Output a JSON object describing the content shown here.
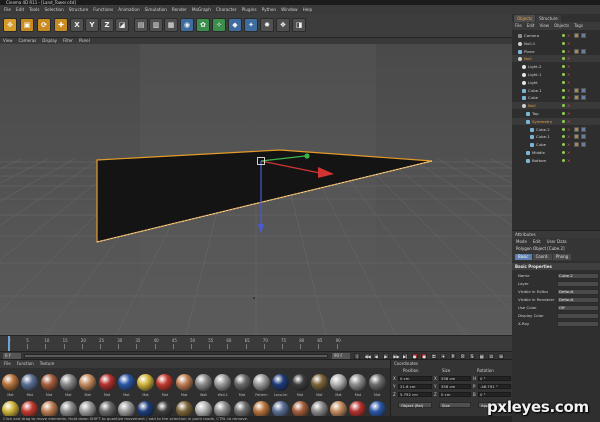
{
  "window": {
    "title": "Cinema 4D R11 - [Land_Tower.c4d]"
  },
  "menu": [
    "File",
    "Edit",
    "Tools",
    "Selection",
    "Structure",
    "Functions",
    "Animation",
    "Simulation",
    "Render",
    "MoGraph",
    "Character",
    "Plugins",
    "Python",
    "Window",
    "Help"
  ],
  "toolbar": {
    "buttons": [
      {
        "glyph": "✥",
        "style": "sel",
        "name": "move-tool-icon"
      },
      {
        "glyph": "▣",
        "style": "o",
        "name": "scale-tool-icon"
      },
      {
        "glyph": "⟳",
        "style": "o",
        "name": "rotate-tool-icon"
      },
      {
        "glyph": "✚",
        "style": "o",
        "name": "live-selection-icon"
      },
      {
        "glyph": "X",
        "style": "",
        "name": "x-axis-icon"
      },
      {
        "glyph": "Y",
        "style": "",
        "name": "y-axis-icon"
      },
      {
        "glyph": "Z",
        "style": "",
        "name": "z-axis-icon"
      },
      {
        "glyph": "◪",
        "style": "",
        "name": "coordinate-system-icon"
      },
      {
        "glyph": "▤",
        "style": "",
        "name": "render-view-icon"
      },
      {
        "glyph": "▥",
        "style": "",
        "name": "render-picture-viewer-icon"
      },
      {
        "glyph": "▦",
        "style": "",
        "name": "render-settings-icon"
      },
      {
        "glyph": "◉",
        "style": "b",
        "name": "cube-primitive-icon"
      },
      {
        "glyph": "✿",
        "style": "g",
        "name": "nurbs-icon"
      },
      {
        "glyph": "✧",
        "style": "g",
        "name": "array-icon"
      },
      {
        "glyph": "◆",
        "style": "b",
        "name": "deformer-icon"
      },
      {
        "glyph": "✦",
        "style": "b",
        "name": "scene-icon"
      },
      {
        "glyph": "✹",
        "style": "",
        "name": "light-icon"
      },
      {
        "glyph": "❖",
        "style": "",
        "name": "effector-icon"
      },
      {
        "glyph": "◨",
        "style": "",
        "name": "camera-icon"
      }
    ]
  },
  "viewport": {
    "menu": [
      "View",
      "Cameras",
      "Display",
      "Filter",
      "Panel"
    ]
  },
  "timeline": {
    "ticks": [
      "0",
      "5",
      "10",
      "15",
      "20",
      "25",
      "30",
      "35",
      "40",
      "45",
      "50",
      "55",
      "60",
      "65",
      "70",
      "75",
      "80",
      "85",
      "90"
    ],
    "start": "0 F",
    "end": "90 F",
    "frame_field": "0 F"
  },
  "materials": {
    "menu": [
      "File",
      "Function",
      "Texture"
    ],
    "items": [
      {
        "label": "Mat",
        "color": "#b8743b"
      },
      {
        "label": "Mat",
        "color": "#5a6f95"
      },
      {
        "label": "Mat",
        "color": "#a65e3b"
      },
      {
        "label": "Mat",
        "color": "#8a8a8a"
      },
      {
        "label": "Mat",
        "color": "#c38b5d"
      },
      {
        "label": "Mat",
        "color": "#b4312d"
      },
      {
        "label": "Mat",
        "color": "#2a56a8"
      },
      {
        "label": "Mat",
        "color": "#d0b33a"
      },
      {
        "label": "Mat",
        "color": "#c23a2e"
      },
      {
        "label": "Mat",
        "color": "#bf7d52"
      },
      {
        "label": "Wall",
        "color": "#8c8c8c"
      },
      {
        "label": "Wall.1",
        "color": "#9b9b9b"
      },
      {
        "label": "Mat",
        "color": "#6a6a6a"
      },
      {
        "label": "Pattern",
        "color": "#9a9a9a"
      },
      {
        "label": "Lava-Im",
        "color": "#1d3c7a"
      },
      {
        "label": "Mat",
        "color": "#3c3c3c"
      },
      {
        "label": "Mat",
        "color": "#7b6438"
      },
      {
        "label": "Mat",
        "color": "#b4b4b4"
      },
      {
        "label": "Mat",
        "color": "#8d8d8d"
      },
      {
        "label": "Mat",
        "color": "#6d6d6d"
      }
    ]
  },
  "coordinates": {
    "title": "Coordinates",
    "headers": [
      "Position",
      "Size",
      "Rotation"
    ],
    "rows": [
      {
        "pos": "0 cm",
        "size": "258 cm",
        "rot": "0 °"
      },
      {
        "pos": "21.6 cm",
        "size": "358 cm",
        "rot": "-46.791 °"
      },
      {
        "pos": "5.792 cm",
        "size": "0 cm",
        "rot": "0 °"
      }
    ],
    "mode": "Object (Rel)",
    "size_mode": "Size",
    "apply": "Apply"
  },
  "status": "Click and drag to move elements. Hold down SHIFT to quantize movement / add to the selection in point mode, CTRL to remove.",
  "objects_panel": {
    "tabs": [
      "Objects",
      "Structure"
    ],
    "menu": [
      "File",
      "Edit",
      "View",
      "Objects",
      "Tags"
    ],
    "rows": [
      {
        "name": "Camera",
        "indent": 1,
        "icon": "cam",
        "sel": false,
        "tag": true
      },
      {
        "name": "Null.1",
        "indent": 1,
        "icon": "null",
        "sel": false,
        "tag": false
      },
      {
        "name": "Plane",
        "indent": 1,
        "icon": "cube",
        "sel": false,
        "tag": true
      },
      {
        "name": "Null",
        "indent": 1,
        "icon": "null",
        "sel": true,
        "tag": false
      },
      {
        "name": "Light.2",
        "indent": 2,
        "icon": "light",
        "sel": false,
        "tag": false
      },
      {
        "name": "Light.1",
        "indent": 2,
        "icon": "light",
        "sel": false,
        "tag": false
      },
      {
        "name": "Light",
        "indent": 2,
        "icon": "light",
        "sel": false,
        "tag": false
      },
      {
        "name": "Cube.1",
        "indent": 2,
        "icon": "cube",
        "sel": false,
        "tag": true
      },
      {
        "name": "Cube",
        "indent": 2,
        "icon": "cube",
        "sel": false,
        "tag": true
      },
      {
        "name": "Null",
        "indent": 2,
        "icon": "null",
        "sel": true,
        "tag": false
      },
      {
        "name": "Top",
        "indent": 3,
        "icon": "cube",
        "sel": false,
        "tag": false
      },
      {
        "name": "Symmetry",
        "indent": 3,
        "icon": "cube",
        "sel": true,
        "tag": false
      },
      {
        "name": "Cube.2",
        "indent": 4,
        "icon": "cube",
        "sel": false,
        "tag": true
      },
      {
        "name": "Cube.1",
        "indent": 4,
        "icon": "cube",
        "sel": false,
        "tag": true
      },
      {
        "name": "Cube",
        "indent": 4,
        "icon": "cube",
        "sel": false,
        "tag": true
      },
      {
        "name": "Middle",
        "indent": 3,
        "icon": "cube",
        "sel": false,
        "tag": false
      },
      {
        "name": "Bottom",
        "indent": 3,
        "icon": "cube",
        "sel": false,
        "tag": false
      }
    ]
  },
  "attributes": {
    "title": "Attributes",
    "menu": [
      "Mode",
      "Edit",
      "User Data"
    ],
    "object": "Polygon Object [Cube.2]",
    "tabs": [
      "Basic",
      "Coord.",
      "Phong"
    ],
    "section": "Basic Properties",
    "rows": [
      {
        "label": "Name",
        "value": "Cube.2"
      },
      {
        "label": "Layer",
        "value": ""
      },
      {
        "label": "Visible in Editor",
        "value": "Default"
      },
      {
        "label": "Visible in Renderer",
        "value": "Default"
      },
      {
        "label": "Use Color",
        "value": "Off"
      },
      {
        "label": "Display Color",
        "value": ""
      },
      {
        "label": "X-Ray",
        "value": ""
      }
    ]
  },
  "watermark": "pxleyes.com"
}
